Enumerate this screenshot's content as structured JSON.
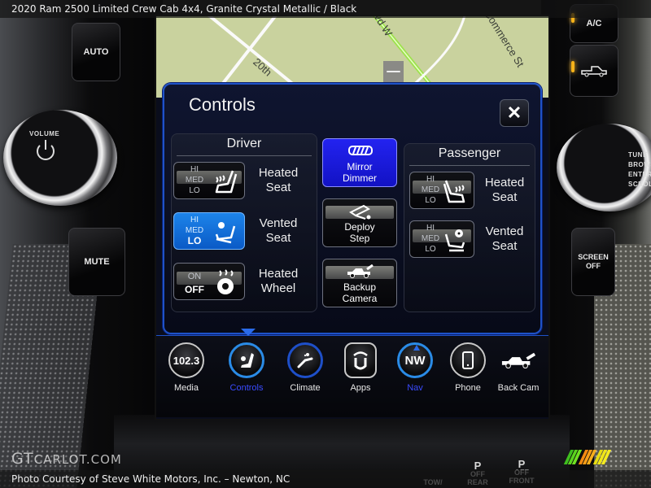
{
  "caption": {
    "title": "2020 Ram 2500 Limited Crew Cab 4x4,  Granite Crystal Metallic / Black",
    "credit": "Photo Courtesy of Steve White Motors, Inc. – Newton, NC",
    "watermark_main": "GT",
    "watermark_rest": "CARLOT.COM"
  },
  "hardware": {
    "auto_label": "AUTO",
    "volume_label": "VOLUME",
    "mute_label": "MUTE",
    "ac_label": "A/C",
    "screen_off_label": "SCREEN OFF",
    "tune_label": "TUNE BROWSE ENTER SCROLL",
    "bottom_switches": [
      "OFF REAR",
      "OFF FRONT",
      "TOW/"
    ]
  },
  "map": {
    "streets": [
      "20th",
      "lvd W",
      "Commerce St"
    ]
  },
  "controls_panel": {
    "title": "Controls",
    "close_icon": "close-icon",
    "driver": {
      "title": "Driver",
      "items": [
        {
          "label_line1": "Heated",
          "label_line2": "Seat",
          "levels": [
            "HI",
            "MED",
            "LO"
          ],
          "selected_level": "",
          "active": false,
          "icon": "heated-seat-icon"
        },
        {
          "label_line1": "Vented",
          "label_line2": "Seat",
          "levels": [
            "HI",
            "MED",
            "LO"
          ],
          "selected_level": "LO",
          "active": true,
          "icon": "vented-seat-icon"
        },
        {
          "label_line1": "Heated",
          "label_line2": "Wheel",
          "levels": [
            "ON",
            "OFF"
          ],
          "selected_level": "OFF",
          "active": false,
          "icon": "heated-wheel-icon"
        }
      ]
    },
    "middle": [
      {
        "label_line1": "Mirror",
        "label_line2": "Dimmer",
        "active": true,
        "icon": "mirror-dimmer-icon"
      },
      {
        "label_line1": "Deploy",
        "label_line2": "Step",
        "active": false,
        "icon": "deploy-step-icon"
      },
      {
        "label_line1": "Backup",
        "label_line2": "Camera",
        "active": false,
        "icon": "backup-camera-icon"
      }
    ],
    "passenger": {
      "title": "Passenger",
      "items": [
        {
          "label_line1": "Heated",
          "label_line2": "Seat",
          "levels": [
            "HI",
            "MED",
            "LO"
          ],
          "selected_level": "",
          "active": false,
          "icon": "heated-seat-icon"
        },
        {
          "label_line1": "Vented",
          "label_line2": "Seat",
          "levels": [
            "HI",
            "MED",
            "LO"
          ],
          "selected_level": "",
          "active": false,
          "icon": "vented-seat-icon"
        }
      ]
    }
  },
  "dock": {
    "selected": "Controls",
    "items": [
      {
        "label": "Media",
        "icon_text": "102.3",
        "icon": "radio-icon"
      },
      {
        "label": "Controls",
        "icon_text": "",
        "icon": "controls-seat-icon"
      },
      {
        "label": "Climate",
        "icon_text": "",
        "icon": "climate-icon"
      },
      {
        "label": "Apps",
        "icon_text": "",
        "icon": "apps-icon"
      },
      {
        "label": "Nav",
        "icon_text": "NW",
        "icon": "compass-icon"
      },
      {
        "label": "Phone",
        "icon_text": "",
        "icon": "phone-icon"
      },
      {
        "label": "Back Cam",
        "icon_text": "",
        "icon": "back-cam-icon"
      }
    ]
  },
  "colors": {
    "accent_blue": "#1d84ea",
    "mirror_dimmer_blue": "#2323f0",
    "selected_label_blue": "#3a4bff",
    "indicator_amber": "#f5b21a"
  }
}
